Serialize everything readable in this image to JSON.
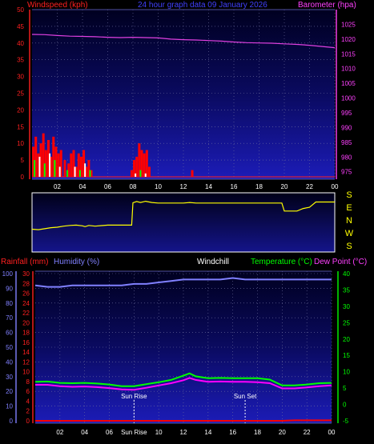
{
  "header": {
    "windspeed_label": "Windspeed (kph)",
    "title": "24 hour graph data  09 January 2026",
    "barometer_label": "Barometer (hpa)"
  },
  "footer": {
    "rainfall_label": "Rainfall (mm)",
    "humidity_label": "Humidity (%)",
    "windchill_label": "Windchill",
    "temperature_label": "Temperature (°C)",
    "dewpoint_label": "Dew Point (°C)",
    "sunrise_label": "Sun Rise",
    "sunset_label": "Sun Set",
    "sunrise_axis_label": "Sun Rise"
  },
  "colors": {
    "background": "#000000",
    "panel_top": "#000030",
    "panel_bottom": "#1a1ab0",
    "wind": "#ff0000",
    "gust_green": "#00ff00",
    "gust_white": "#ffffff",
    "barometer": "#e040e0",
    "direction": "#ffff00",
    "humidity": "#8080ff",
    "temperature": "#00ff00",
    "dewpoint": "#ff00ff",
    "rain": "#ff0000",
    "title": "#4040ff",
    "axis_label_red": "#ff2020",
    "axis_label_green": "#00ff00",
    "axis_label_magenta": "#ff40ff"
  },
  "chart_data": [
    {
      "type": "line",
      "title": "24 hour graph data  09 January 2026",
      "x_ticks": [
        "02",
        "04",
        "06",
        "08",
        "10",
        "12",
        "14",
        "16",
        "18",
        "20",
        "22",
        "00"
      ],
      "xlim": [
        0,
        24
      ],
      "ylabel_left": "Windspeed (kph)",
      "ylim_left": [
        0,
        50
      ],
      "yticks_left": [
        0,
        5,
        10,
        15,
        20,
        25,
        30,
        35,
        40,
        45,
        50
      ],
      "ylabel_right": "Barometer (hpa)",
      "ylim_right": [
        973.3,
        1030
      ],
      "yticks_right": [
        975,
        980,
        985,
        990,
        995,
        1000,
        1005,
        1010,
        1015,
        1020,
        1025
      ],
      "series": [
        {
          "name": "Barometer (hpa)",
          "axis": "right",
          "x": [
            0,
            1,
            2,
            3,
            4,
            5,
            6,
            7,
            8,
            9,
            10,
            11,
            12,
            13,
            14,
            15,
            16,
            17,
            18,
            19,
            20,
            21,
            22,
            23,
            24
          ],
          "y": [
            1021.6,
            1021.5,
            1021.2,
            1021.0,
            1020.9,
            1020.8,
            1020.6,
            1020.5,
            1020.6,
            1020.5,
            1020.4,
            1020.0,
            1019.8,
            1019.7,
            1019.5,
            1019.3,
            1019.0,
            1018.8,
            1018.7,
            1018.6,
            1018.4,
            1018.2,
            1017.9,
            1017.5,
            1017.1
          ]
        },
        {
          "name": "Windspeed (kph)",
          "axis": "left",
          "x": [
            0.1,
            0.3,
            0.5,
            0.7,
            0.9,
            1.1,
            1.3,
            1.5,
            1.7,
            1.9,
            2.1,
            2.3,
            2.6,
            2.9,
            3.1,
            3.3,
            3.5,
            3.7,
            3.9,
            4.1,
            4.3,
            4.5,
            4.7,
            7.9,
            8.1,
            8.3,
            8.5,
            8.7,
            8.9,
            9.1,
            9.3,
            12.7
          ],
          "y": [
            9,
            12,
            7,
            10,
            13,
            8,
            11,
            6,
            12,
            9,
            7,
            8,
            5,
            4,
            7,
            8,
            3,
            7,
            6,
            8,
            3,
            5,
            2,
            2,
            5,
            6,
            10,
            8,
            7,
            8,
            3,
            2
          ]
        },
        {
          "name": "Gust",
          "axis": "left",
          "x": [
            0.2,
            0.6,
            1.0,
            1.4,
            1.8,
            2.2,
            2.8,
            3.4,
            3.8,
            4.2,
            4.6,
            8.2,
            8.6,
            9.0
          ],
          "y": [
            5,
            6,
            4,
            7,
            5,
            3,
            2,
            3,
            2,
            4,
            2,
            1,
            2,
            1
          ]
        }
      ]
    },
    {
      "type": "line",
      "title": "",
      "x_ticks": [
        "02",
        "04",
        "06",
        "08",
        "10",
        "12",
        "14",
        "16",
        "18",
        "20",
        "22",
        "00"
      ],
      "xlim": [
        0,
        24
      ],
      "ylabels_right": [
        "S",
        "E",
        "N",
        "W",
        "S"
      ],
      "series": [
        {
          "name": "Wind direction",
          "x": [
            0,
            0.5,
            1.0,
            1.5,
            2.0,
            2.5,
            3.0,
            3.5,
            4.0,
            4.2,
            4.5,
            5.0,
            5.5,
            6.0,
            7.0,
            7.9,
            8.0,
            8.3,
            8.6,
            9.0,
            9.5,
            10,
            11,
            12,
            12.5,
            13,
            14,
            15,
            16,
            17,
            18,
            19,
            19.8,
            20,
            21,
            21.5,
            22,
            22.5,
            23,
            24
          ],
          "y": [
            225,
            228,
            222,
            215,
            212,
            205,
            200,
            198,
            203,
            208,
            200,
            205,
            201,
            198,
            198,
            198,
            50,
            42,
            48,
            40,
            48,
            52,
            52,
            52,
            48,
            52,
            52,
            52,
            52,
            52,
            52,
            52,
            52,
            105,
            105,
            88,
            80,
            45,
            45,
            45
          ]
        }
      ]
    },
    {
      "type": "line",
      "title": "",
      "x_ticks": [
        "02",
        "04",
        "06",
        "Sun Rise",
        "10",
        "12",
        "14",
        "16",
        "18",
        "20",
        "22",
        "00"
      ],
      "xlim": [
        0,
        24
      ],
      "ylabel_left_rain": "Rainfall (mm)",
      "yticks_left_rain": [
        0,
        2,
        4,
        6,
        8,
        10,
        12,
        14,
        16,
        18,
        20,
        22,
        24,
        26,
        28,
        30
      ],
      "ylabel_left_humidity": "Humidity (%)",
      "ylim_left_humidity": [
        0,
        100
      ],
      "yticks_left_humidity": [
        0,
        10,
        20,
        30,
        40,
        50,
        60,
        70,
        80,
        90,
        100
      ],
      "ylabel_right": "Temperature (°C)",
      "ylim_right": [
        -5,
        40
      ],
      "yticks_right": [
        -5,
        0,
        5,
        10,
        15,
        20,
        25,
        30,
        35,
        40
      ],
      "sunrise_hour": 8.0,
      "sunset_hour": 17.0,
      "series": [
        {
          "name": "Humidity (%)",
          "axis": "left",
          "x": [
            0,
            1,
            2,
            3,
            4,
            5,
            6,
            7,
            8,
            9,
            10,
            11,
            12,
            13,
            14,
            15,
            16,
            17,
            18,
            19,
            20,
            21,
            22,
            23,
            24
          ],
          "y": [
            92,
            91,
            91,
            92,
            92,
            92,
            92,
            92,
            93,
            93,
            94,
            95,
            96,
            96,
            96,
            96,
            97,
            96,
            96,
            96,
            96,
            96,
            96,
            96,
            96
          ]
        },
        {
          "name": "Temperature (°C)",
          "axis": "right",
          "x": [
            0,
            1,
            2,
            3,
            4,
            5,
            6,
            7,
            8,
            9,
            10,
            11,
            12,
            12.5,
            13,
            14,
            15,
            16,
            17,
            18,
            19,
            20,
            21,
            22,
            23,
            24
          ],
          "y": [
            6.9,
            7.0,
            6.6,
            6.5,
            6.6,
            6.4,
            6.1,
            5.6,
            5.6,
            6.2,
            6.8,
            7.5,
            8.8,
            9.5,
            8.6,
            8.0,
            8.1,
            8.0,
            8.0,
            8.0,
            7.6,
            5.8,
            5.8,
            6.1,
            6.5,
            6.6
          ]
        },
        {
          "name": "Dew Point (°C)",
          "axis": "right",
          "x": [
            0,
            1,
            2,
            3,
            4,
            5,
            6,
            7,
            8,
            9,
            10,
            11,
            12,
            12.5,
            13,
            14,
            15,
            16,
            17,
            18,
            19,
            20,
            21,
            22,
            23,
            24
          ],
          "y": [
            6.0,
            6.0,
            5.6,
            5.4,
            5.5,
            5.3,
            5.0,
            4.6,
            4.5,
            5.1,
            5.8,
            6.5,
            7.4,
            8.1,
            7.5,
            6.9,
            7.0,
            6.9,
            6.9,
            6.8,
            6.5,
            4.9,
            4.9,
            5.2,
            5.6,
            5.8
          ]
        },
        {
          "name": "Rainfall (mm)",
          "axis": "left_rain",
          "x": [
            0,
            20,
            21,
            22,
            23,
            24
          ],
          "y": [
            0,
            0,
            0.1,
            0.1,
            0.1,
            0.1
          ]
        }
      ]
    }
  ]
}
